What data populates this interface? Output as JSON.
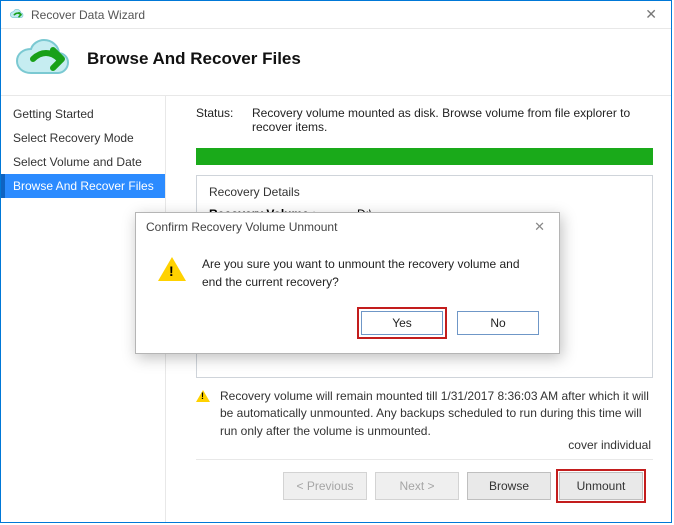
{
  "window": {
    "title": "Recover Data Wizard"
  },
  "heading": "Browse And Recover Files",
  "sidebar": {
    "items": [
      {
        "label": "Getting Started"
      },
      {
        "label": "Select Recovery Mode"
      },
      {
        "label": "Select Volume and Date"
      },
      {
        "label": "Browse And Recover Files"
      }
    ],
    "active_index": 3
  },
  "status": {
    "label": "Status:",
    "text": "Recovery volume mounted as disk. Browse volume from file explorer to recover items."
  },
  "details": {
    "group_title": "Recovery Details",
    "volume_label": "Recovery Volume :",
    "volume_value": "D:\\",
    "trail_text": "cover individual"
  },
  "warning": "Recovery volume will remain mounted till 1/31/2017 8:36:03 AM after which it will be automatically unmounted. Any backups scheduled to run during this time will run only after the volume is unmounted.",
  "footer": {
    "previous": "< Previous",
    "next": "Next >",
    "browse": "Browse",
    "unmount": "Unmount"
  },
  "dialog": {
    "title": "Confirm Recovery Volume Unmount",
    "message": "Are you sure you want to unmount the recovery volume and end the current recovery?",
    "yes": "Yes",
    "no": "No"
  }
}
